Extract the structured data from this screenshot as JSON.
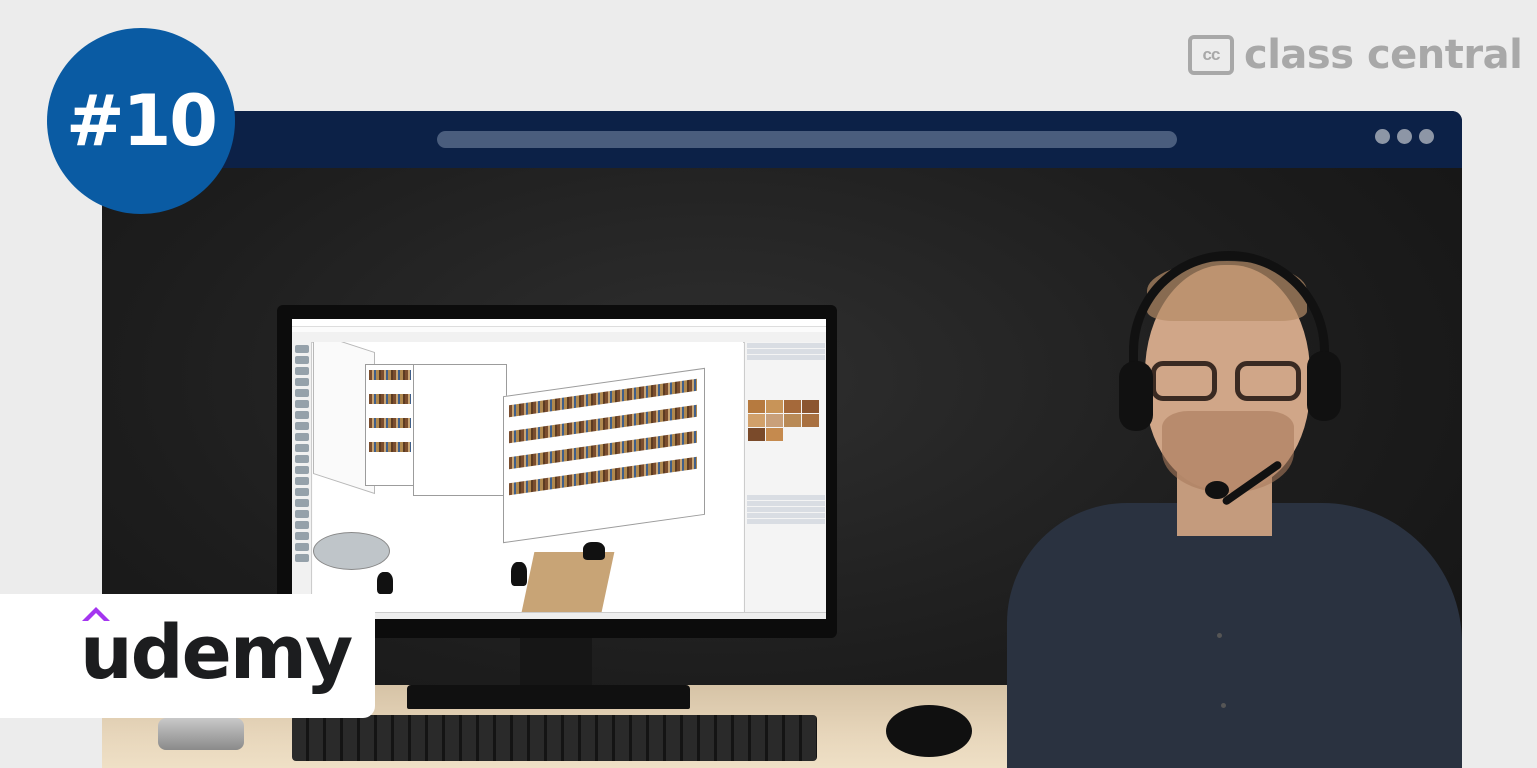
{
  "brand": {
    "cc_icon": "cc",
    "cc_name": "class central"
  },
  "rank": "#10",
  "provider": {
    "name": "udemy",
    "accent": "#a435f0"
  },
  "colors": {
    "badge": "#0a5ba3",
    "frame": "#0c2147",
    "background": "#ececec"
  },
  "icons": [
    "class-central-logo-icon",
    "udemy-hat-icon",
    "window-dots-icon"
  ]
}
